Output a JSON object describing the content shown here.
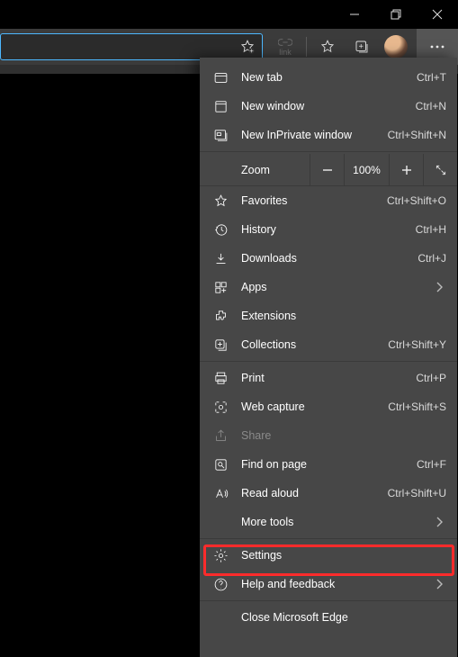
{
  "titlebar": {
    "min_tip": "Minimize",
    "max_tip": "Restore",
    "close_tip": "Close"
  },
  "toolbar": {
    "link_label": "link",
    "fav_tip": "Add this page to favorites",
    "favbar_tip": "Favorites",
    "collections_tip": "Collections",
    "profile_tip": "Profile",
    "more_tip": "Settings and more"
  },
  "menu": {
    "new_tab": {
      "label": "New tab",
      "shortcut": "Ctrl+T"
    },
    "new_window": {
      "label": "New window",
      "shortcut": "Ctrl+N"
    },
    "new_inprivate": {
      "label": "New InPrivate window",
      "shortcut": "Ctrl+Shift+N"
    },
    "zoom": {
      "label": "Zoom",
      "pct": "100%"
    },
    "favorites": {
      "label": "Favorites",
      "shortcut": "Ctrl+Shift+O"
    },
    "history": {
      "label": "History",
      "shortcut": "Ctrl+H"
    },
    "downloads": {
      "label": "Downloads",
      "shortcut": "Ctrl+J"
    },
    "apps": {
      "label": "Apps"
    },
    "extensions": {
      "label": "Extensions"
    },
    "collections": {
      "label": "Collections",
      "shortcut": "Ctrl+Shift+Y"
    },
    "print": {
      "label": "Print",
      "shortcut": "Ctrl+P"
    },
    "webcapture": {
      "label": "Web capture",
      "shortcut": "Ctrl+Shift+S"
    },
    "share": {
      "label": "Share"
    },
    "find": {
      "label": "Find on page",
      "shortcut": "Ctrl+F"
    },
    "readaloud": {
      "label": "Read aloud",
      "shortcut": "Ctrl+Shift+U"
    },
    "moretools": {
      "label": "More tools"
    },
    "settings": {
      "label": "Settings"
    },
    "help": {
      "label": "Help and feedback"
    },
    "close": {
      "label": "Close Microsoft Edge"
    }
  }
}
